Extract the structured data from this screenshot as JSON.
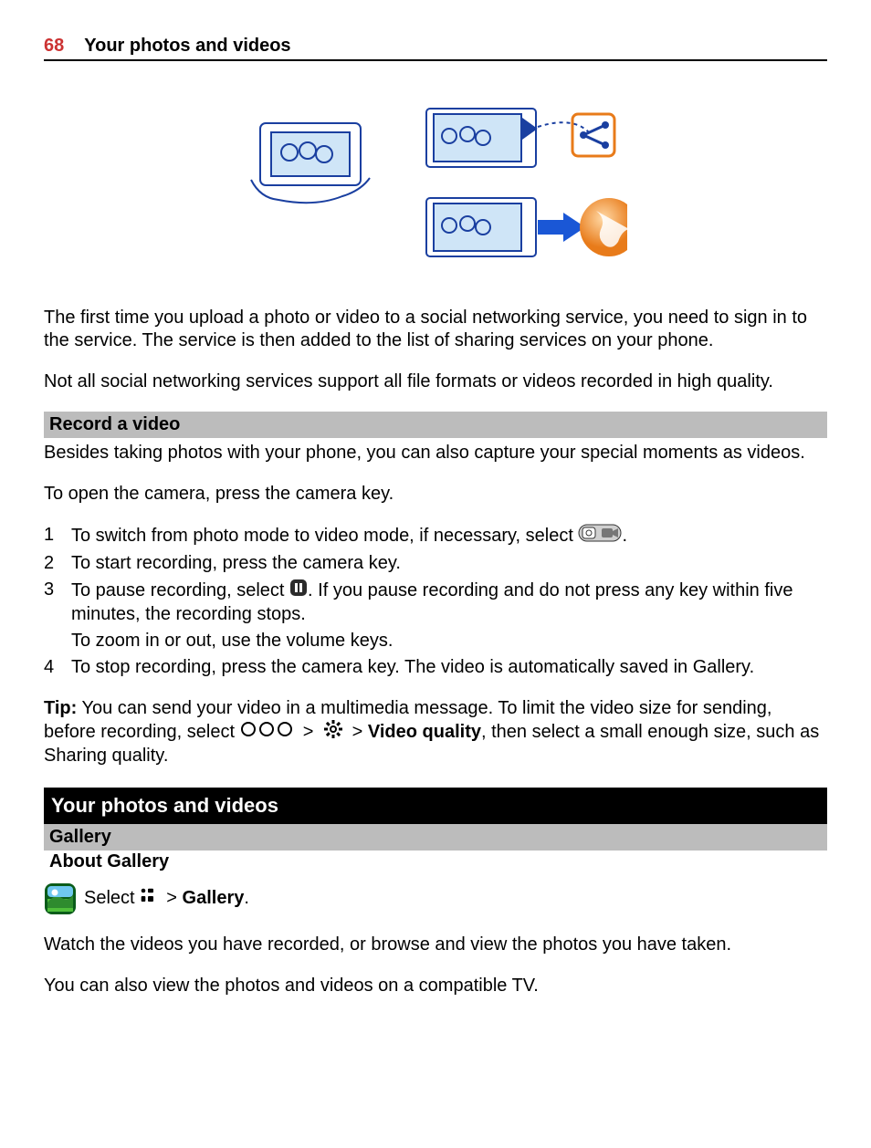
{
  "header": {
    "page_number": "68",
    "title": "Your photos and videos"
  },
  "intro": {
    "p1": "The first time you upload a photo or video to a social networking service, you need to sign in to the service. The service is then added to the list of sharing services on your phone.",
    "p2": "Not all social networking services support all file formats or videos recorded in high quality."
  },
  "record": {
    "heading": "Record a video",
    "p1": "Besides taking photos with your phone, you can also capture your special moments as videos.",
    "p2": "To open the camera, press the camera key.",
    "steps": {
      "s1": "To switch from photo mode to video mode, if necessary, select ",
      "s1_end": ".",
      "s2": "To start recording, press the camera key.",
      "s3a": "To pause recording, select ",
      "s3b": ". If you pause recording and do not press any key within five minutes, the recording stops.",
      "s3c": "To zoom in or out, use the volume keys.",
      "s4": "To stop recording, press the camera key. The video is automatically saved in Gallery."
    },
    "tip_label": "Tip:",
    "tip_a": " You can send your video in a multimedia message. To limit the video size for sending, before recording, select ",
    "tip_b": "Video quality",
    "tip_c": ", then select a small enough size, such as Sharing quality."
  },
  "section2": {
    "title": "Your photos and videos",
    "sub1": "Gallery",
    "sub2": "About Gallery",
    "select_text": "Select ",
    "gallery_label": "Gallery",
    "p1": "Watch the videos you have recorded, or browse and view the photos you have taken.",
    "p2": "You can also view the photos and videos on a compatible TV."
  },
  "glyphs": {
    "gt": ">",
    "period": "."
  }
}
